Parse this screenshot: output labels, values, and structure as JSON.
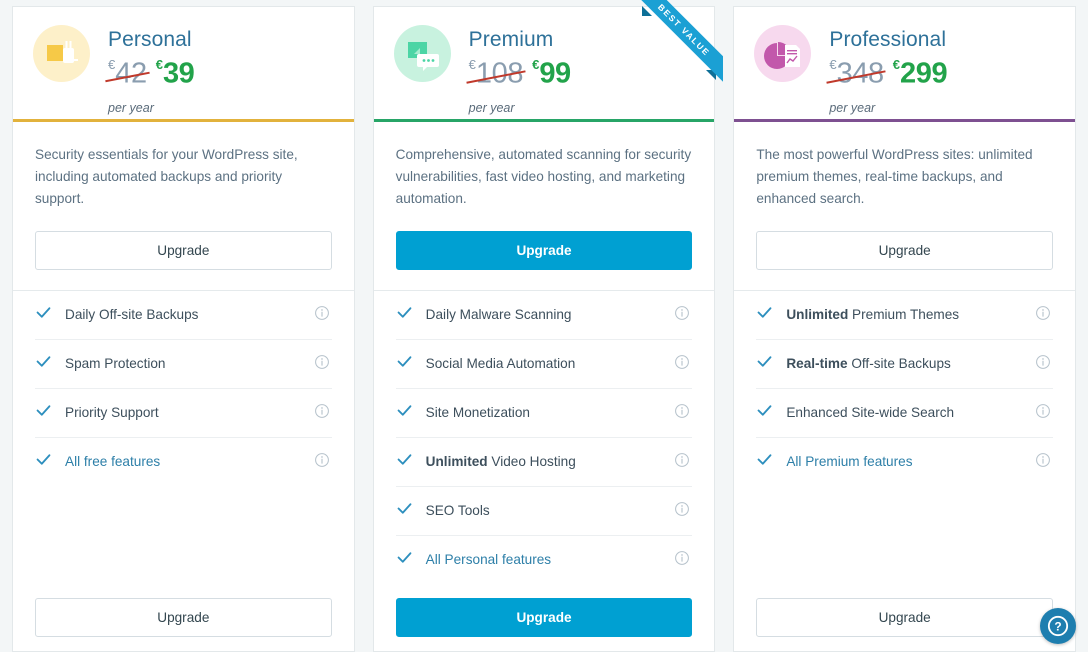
{
  "currency": "€",
  "ribbon": {
    "label": "BEST VALUE",
    "color": "#1ba0d4"
  },
  "help": {
    "icon": "question-mark-icon",
    "label": "?"
  },
  "per_period": "per year",
  "colors": {
    "personal_accent": "#e0b busy",
    "page_background": "#f3f6f7",
    "primary_button": "#00a0d2",
    "old_price": "#8a9daf",
    "new_price": "#22a34a",
    "strike": "#c0392b"
  },
  "plans": [
    {
      "id": "personal",
      "name": "Personal",
      "icon": "plug-outlet-icon",
      "icon_bg": "#fdf0c9",
      "icon_fg": "#f6c947",
      "accent": "#e2b23c",
      "old_price": "42",
      "new_price": "39",
      "description": "Security essentials for your WordPress site, including automated backups and priority support.",
      "upgrade_label": "Upgrade",
      "upgrade_style": "ghost",
      "footer_upgrade_label": "Upgrade",
      "features": [
        {
          "bold": "",
          "text": "Daily Off-site Backups",
          "link": false,
          "info": "info-icon"
        },
        {
          "bold": "",
          "text": "Spam Protection",
          "link": false,
          "info": "info-icon"
        },
        {
          "bold": "",
          "text": "Priority Support",
          "link": false,
          "info": "info-icon"
        },
        {
          "bold": "",
          "text": "All free features",
          "link": true,
          "info": "info-icon"
        }
      ]
    },
    {
      "id": "premium",
      "name": "Premium",
      "icon": "speech-bubble-icon",
      "icon_bg": "#c8f2df",
      "icon_fg": "#4cd5a5",
      "accent": "#27a567",
      "old_price": "108",
      "new_price": "99",
      "description": "Comprehensive, automated scanning for security vulnerabilities, fast video hosting, and marketing automation.",
      "upgrade_label": "Upgrade",
      "upgrade_style": "solid",
      "footer_upgrade_label": "Upgrade",
      "badge": "BEST VALUE",
      "features": [
        {
          "bold": "",
          "text": "Daily Malware Scanning",
          "link": false,
          "info": "info-icon"
        },
        {
          "bold": "",
          "text": "Social Media Automation",
          "link": false,
          "info": "info-icon"
        },
        {
          "bold": "",
          "text": "Site Monetization",
          "link": false,
          "info": "info-icon"
        },
        {
          "bold": "Unlimited",
          "text": " Video Hosting",
          "link": false,
          "info": "info-icon"
        },
        {
          "bold": "",
          "text": "SEO Tools",
          "link": false,
          "info": "info-icon"
        },
        {
          "bold": "",
          "text": "All Personal features",
          "link": true,
          "info": "info-icon"
        }
      ]
    },
    {
      "id": "professional",
      "name": "Professional",
      "icon": "pie-chart-document-icon",
      "icon_bg": "#f7d9ee",
      "icon_fg": "#c258ab",
      "accent": "#7e5091",
      "old_price": "348",
      "new_price": "299",
      "description": "The most powerful WordPress sites: unlimited premium themes, real-time backups, and enhanced search.",
      "upgrade_label": "Upgrade",
      "upgrade_style": "ghost",
      "footer_upgrade_label": "Upgrade",
      "features": [
        {
          "bold": "Unlimited",
          "text": " Premium Themes",
          "link": false,
          "info": "info-icon"
        },
        {
          "bold": "Real-time",
          "text": " Off-site Backups",
          "link": false,
          "info": "info-icon"
        },
        {
          "bold": "",
          "text": "Enhanced Site-wide Search",
          "link": false,
          "info": "info-icon"
        },
        {
          "bold": "",
          "text": "All Premium features",
          "link": true,
          "info": "info-icon"
        }
      ]
    }
  ]
}
